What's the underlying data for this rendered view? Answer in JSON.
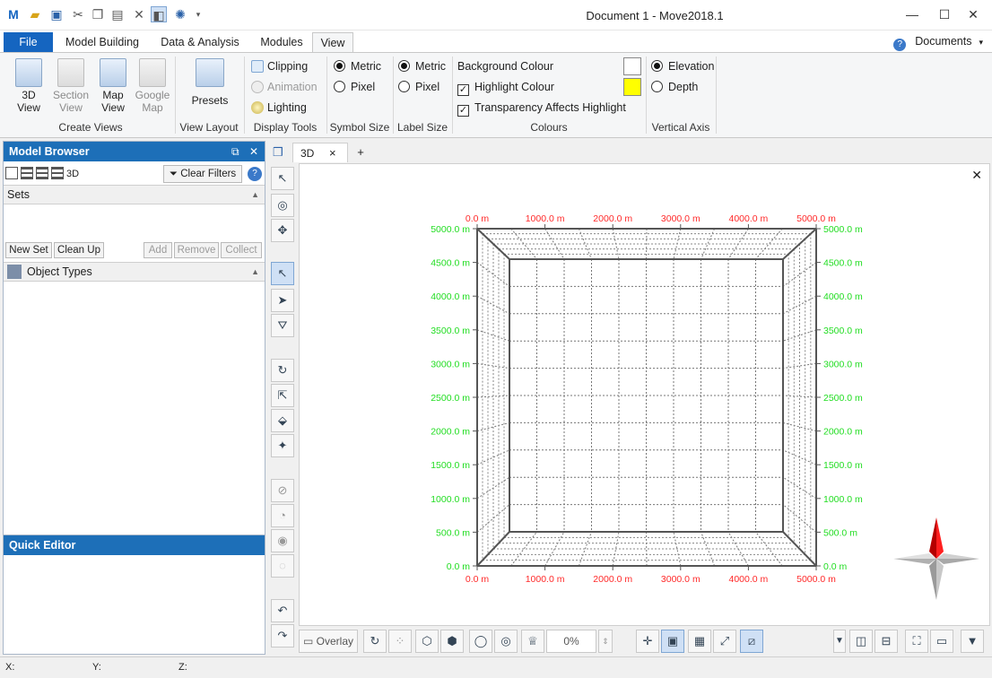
{
  "window": {
    "title": "Document 1 - Move2018.1"
  },
  "quick_access": [
    "app-logo-icon",
    "open-folder-icon",
    "save-icon",
    "cut-icon",
    "copy-icon",
    "paste-icon",
    "delete-icon",
    "panel-toggle-icon",
    "settings-icon",
    "dropdown-icon"
  ],
  "tabs": {
    "file": "File",
    "model_building": "Model Building",
    "data_analysis": "Data & Analysis",
    "modules": "Modules",
    "view": "View",
    "documents": "Documents"
  },
  "ribbon": {
    "create_views": {
      "label": "Create Views",
      "view3d": "3D\nView",
      "section_view": "Section\nView",
      "map_view": "Map\nView",
      "google_map": "Google\nMap"
    },
    "view_layout": {
      "label": "View Layout",
      "presets": "Presets"
    },
    "display_tools": {
      "label": "Display Tools",
      "clipping": "Clipping",
      "animation": "Animation",
      "lighting": "Lighting"
    },
    "symbol_size": {
      "label": "Symbol Size",
      "metric": "Metric",
      "pixel": "Pixel"
    },
    "label_size": {
      "label": "Label Size",
      "metric": "Metric",
      "pixel": "Pixel"
    },
    "colours": {
      "label": "Colours",
      "background": "Background Colour",
      "highlight": "Highlight Colour",
      "transparency": "Transparency Affects Highlight",
      "background_color": "#ffffff",
      "highlight_color": "#ffff00"
    },
    "vertical_axis": {
      "label": "Vertical Axis",
      "elevation": "Elevation",
      "depth": "Depth"
    }
  },
  "model_browser": {
    "title": "Model Browser",
    "mode_3d": "3D",
    "clear_filters": "Clear Filters",
    "sets": "Sets",
    "new_set": "New Set",
    "clean_up": "Clean Up",
    "add": "Add",
    "remove": "Remove",
    "collect": "Collect",
    "object_types": "Object Types"
  },
  "quick_editor": {
    "title": "Quick Editor"
  },
  "viewport": {
    "tab_3d": "3D",
    "add_tab": "+",
    "close": "×",
    "top_labels": [
      "0.0 m",
      "1000.0 m",
      "2000.0 m",
      "3000.0 m",
      "4000.0 m",
      "5000.0 m"
    ],
    "bottom_labels": [
      "0.0 m",
      "1000.0 m",
      "2000.0 m",
      "3000.0 m",
      "4000.0 m",
      "5000.0 m"
    ],
    "left_labels": [
      "5000.0 m",
      "4500.0 m",
      "4000.0 m",
      "3500.0 m",
      "3000.0 m",
      "2500.0 m",
      "2000.0 m",
      "1500.0 m",
      "1000.0 m",
      "500.0 m",
      "0.0 m"
    ],
    "right_labels": [
      "5000.0 m",
      "4500.0 m",
      "4000.0 m",
      "3500.0 m",
      "3000.0 m",
      "2500.0 m",
      "2000.0 m",
      "1500.0 m",
      "1000.0 m",
      "500.0 m",
      "0.0 m"
    ],
    "x_label_color": "#ff2a2a",
    "y_label_color": "#22dd22"
  },
  "bottom_toolbar": {
    "overlay": "Overlay",
    "opacity": "0%"
  },
  "status": {
    "x": "X:",
    "y": "Y:",
    "z": "Z:"
  }
}
